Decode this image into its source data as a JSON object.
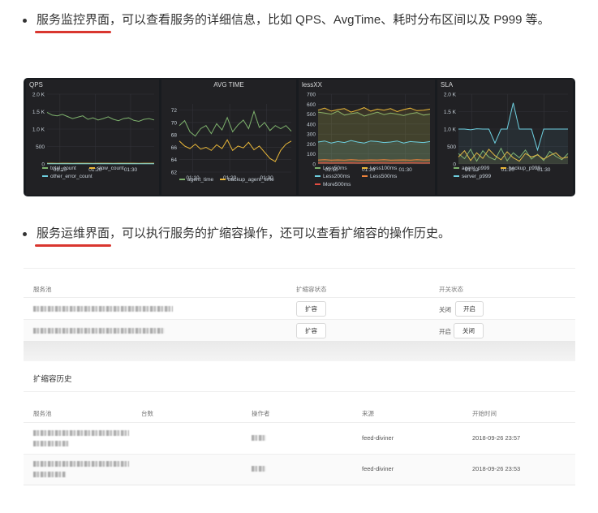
{
  "bullet1": {
    "highlight": "服务监控界面",
    "text": "，可以查看服务的详细信息，比如 QPS、AvgTime、耗时分布区间以及 P999 等。"
  },
  "bullet2": {
    "highlight": "服务运维界面",
    "text": "，可以执行服务的扩缩容操作，还可以查看扩缩容的操作历史。"
  },
  "chart_data": [
    {
      "type": "line",
      "title": "QPS",
      "x_ticks": [
        "01:10",
        "01:20",
        "01:30"
      ],
      "y_ticks": [
        "0",
        "500",
        "1.0 K",
        "1.5 K",
        "2.0 K"
      ],
      "ylim": [
        0,
        2000
      ],
      "series": [
        {
          "name": "total_count",
          "color": "#7eb26d",
          "values": [
            1480,
            1400,
            1380,
            1420,
            1360,
            1300,
            1340,
            1380,
            1280,
            1320,
            1260,
            1300,
            1350,
            1280,
            1240,
            1300,
            1320,
            1250,
            1220,
            1280,
            1300,
            1260
          ]
        },
        {
          "name": "slow_count",
          "color": "#eab839",
          "values": [
            20,
            22,
            18,
            20,
            20,
            19,
            21,
            20,
            20,
            18,
            20,
            21,
            20,
            19,
            20,
            20,
            21,
            20,
            19,
            20,
            20,
            20
          ]
        },
        {
          "name": "other_error_count",
          "color": "#6ed0e0",
          "values": [
            4,
            4,
            4,
            4,
            4,
            4,
            4,
            4,
            4,
            4,
            4,
            4,
            4,
            4,
            4,
            4,
            4,
            4,
            4,
            4,
            4,
            4
          ]
        }
      ]
    },
    {
      "type": "line",
      "title": "AVG TIME",
      "x_ticks": [
        "01:10",
        "01:20",
        "01:30"
      ],
      "y_ticks": [
        "62",
        "64",
        "66",
        "68",
        "70",
        "72"
      ],
      "ylim": [
        62,
        73
      ],
      "series": [
        {
          "name": "agent_time",
          "color": "#7eb26d",
          "values": [
            69.5,
            70.3,
            68.5,
            67.8,
            69.0,
            69.5,
            68.2,
            69.8,
            68.8,
            70.8,
            68.5,
            69.6,
            70.4,
            69.0,
            71.8,
            69.2,
            70.0,
            68.7,
            69.5,
            69.0,
            69.5,
            68.6
          ]
        },
        {
          "name": "backup_agent_time",
          "color": "#eab839",
          "values": [
            67.0,
            66.2,
            65.8,
            66.5,
            65.7,
            66.0,
            65.5,
            66.4,
            65.8,
            67.2,
            65.5,
            66.2,
            65.9,
            66.8,
            65.6,
            66.2,
            65.2,
            64.2,
            63.7,
            65.5,
            66.5,
            67.0
          ]
        }
      ]
    },
    {
      "type": "area",
      "title": "lessXX",
      "x_ticks": [
        "01:10",
        "01:20",
        "01:30"
      ],
      "y_ticks": [
        "0",
        "100",
        "200",
        "300",
        "400",
        "500",
        "600",
        "700"
      ],
      "ylim": [
        0,
        700
      ],
      "series": [
        {
          "name": "Less50ms",
          "color": "#7eb26d",
          "values": [
            520,
            510,
            500,
            530,
            490,
            505,
            515,
            480,
            500,
            520,
            495,
            510,
            500,
            485,
            505,
            515,
            490,
            500
          ]
        },
        {
          "name": "Less100ms",
          "color": "#eab839",
          "values": [
            540,
            560,
            530,
            545,
            555,
            520,
            540,
            565,
            530,
            550,
            540,
            555,
            525,
            545,
            560,
            535,
            540,
            550
          ]
        },
        {
          "name": "Less200ms",
          "color": "#6ed0e0",
          "values": [
            220,
            230,
            210,
            225,
            215,
            235,
            220,
            210,
            230,
            225,
            215,
            220,
            230,
            210,
            225,
            220,
            215,
            225
          ]
        },
        {
          "name": "Less500ms",
          "color": "#ef843c",
          "values": [
            40,
            42,
            38,
            41,
            39,
            43,
            40,
            38,
            41,
            40,
            42,
            39,
            40,
            41,
            38,
            42,
            40,
            41
          ]
        },
        {
          "name": "More500ms",
          "color": "#e24d42",
          "values": [
            10,
            11,
            9,
            10,
            10,
            11,
            9,
            10,
            10,
            11,
            10,
            9,
            10,
            10,
            11,
            10,
            9,
            10
          ]
        }
      ]
    },
    {
      "type": "line",
      "title": "SLA",
      "x_ticks": [
        "01:10",
        "01:20",
        "01:30"
      ],
      "y_ticks": [
        "0",
        "500",
        "1.0 K",
        "1.5 K",
        "2.0 K"
      ],
      "ylim": [
        0,
        2000
      ],
      "series": [
        {
          "name": "agent_p999",
          "color": "#7eb26d",
          "values": [
            300,
            150,
            420,
            80,
            380,
            200,
            120,
            450,
            90,
            320,
            180,
            400,
            140,
            280,
            100,
            360,
            220,
            120,
            300
          ]
        },
        {
          "name": "backup_p999",
          "color": "#eab839",
          "values": [
            200,
            380,
            100,
            320,
            160,
            420,
            240,
            120,
            350,
            180,
            80,
            300,
            200,
            260,
            140,
            240,
            320,
            160,
            200
          ]
        },
        {
          "name": "server_p999",
          "color": "#6ed0e0",
          "values": [
            1000,
            1000,
            980,
            1010,
            1000,
            1000,
            600,
            1000,
            1000,
            1750,
            1000,
            1000,
            1000,
            400,
            1000,
            1000,
            1000,
            1000,
            1000
          ]
        }
      ]
    }
  ],
  "ops_table": {
    "headers": {
      "pool": "服务池",
      "scale_status": "扩缩容状态",
      "switch_status": "开关状态"
    },
    "rows": [
      {
        "scale_button": "扩容",
        "switch_label": "关闭",
        "switch_button": "开启"
      },
      {
        "scale_button": "扩容",
        "switch_label": "开启",
        "switch_button": "关闭"
      }
    ]
  },
  "history": {
    "title": "扩缩容历史",
    "headers": {
      "pool": "服务池",
      "count": "台数",
      "operator": "操作者",
      "source": "来源",
      "time": "开始时间"
    },
    "rows": [
      {
        "source": "feed-diviner",
        "time": "2018-09-26 23:57"
      },
      {
        "source": "feed-diviner",
        "time": "2018-09-26 23:53"
      }
    ]
  }
}
